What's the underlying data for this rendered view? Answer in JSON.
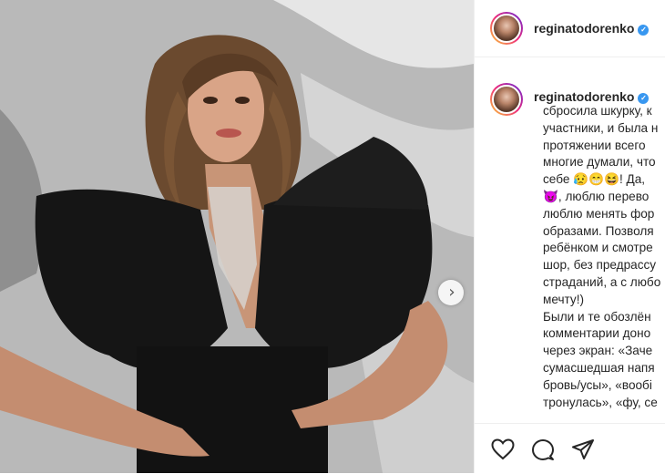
{
  "post": {
    "username": "reginatodorenko",
    "verified_badge": "✓",
    "next_arrow": "›",
    "caption": "сбросила шкурку, к\nучастники, и была н\nпротяжении всего \nмногие думали, что\nсебе 😥😁😆! Да,\n😈, люблю перево\nлюблю менять фор\nобразами. Позволя\nребёнком и смотре\nшор, без предрассу\nстраданий, а с любо\nмечту!)\nБыли и те обозлён\nкомментарии доно\nчерез экран: «Заче\nсумасшедшая напя\nбровь/усы», «вообі\nтронулась», «фу, се"
  },
  "icons": {
    "like": "heart-icon",
    "comment": "comment-icon",
    "share": "share-icon",
    "next": "chevron-right-icon"
  },
  "colors": {
    "verified": "#3897f0",
    "text": "#262626",
    "border": "#efefef"
  }
}
